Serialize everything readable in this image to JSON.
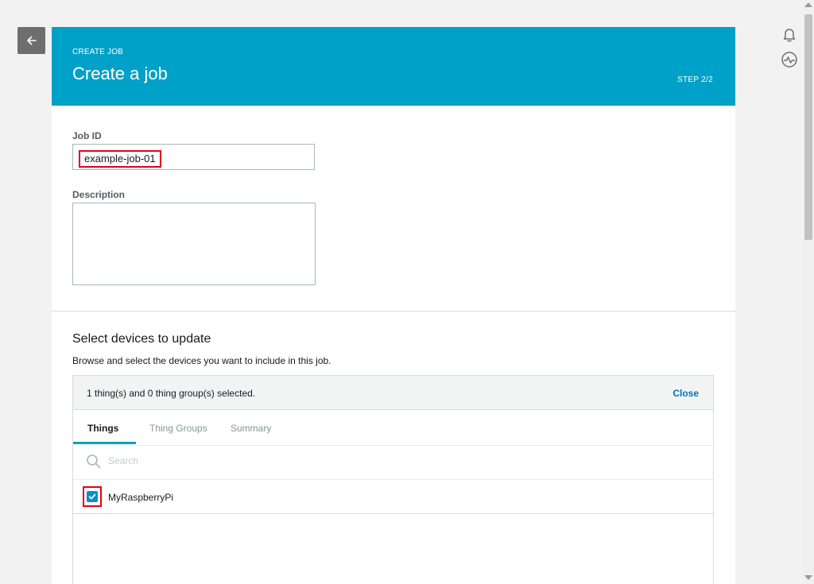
{
  "header": {
    "crumb": "CREATE JOB",
    "title": "Create a job",
    "step": "STEP 2/2"
  },
  "form": {
    "job_id_label": "Job ID",
    "job_id_value": "example-job-01",
    "description_label": "Description",
    "description_value": ""
  },
  "devices": {
    "title": "Select devices to update",
    "subtitle": "Browse and select the devices you want to include in this job.",
    "selection_status": "1 thing(s) and 0 thing group(s) selected.",
    "close_label": "Close",
    "tabs": [
      {
        "label": "Things",
        "active": true
      },
      {
        "label": "Thing Groups",
        "active": false
      },
      {
        "label": "Summary",
        "active": false
      }
    ],
    "search_placeholder": "Search",
    "things": [
      {
        "name": "MyRaspberryPi",
        "checked": true
      }
    ]
  },
  "icons": {
    "back": "arrow-left-icon",
    "notifications": "bell-icon",
    "activity": "pulse-icon",
    "search": "search-icon",
    "check": "check-icon"
  },
  "colors": {
    "header_bg": "#00a1c9",
    "accent_link": "#0073bb",
    "checkbox": "#0a8fc4",
    "highlight": "#e3001b"
  }
}
